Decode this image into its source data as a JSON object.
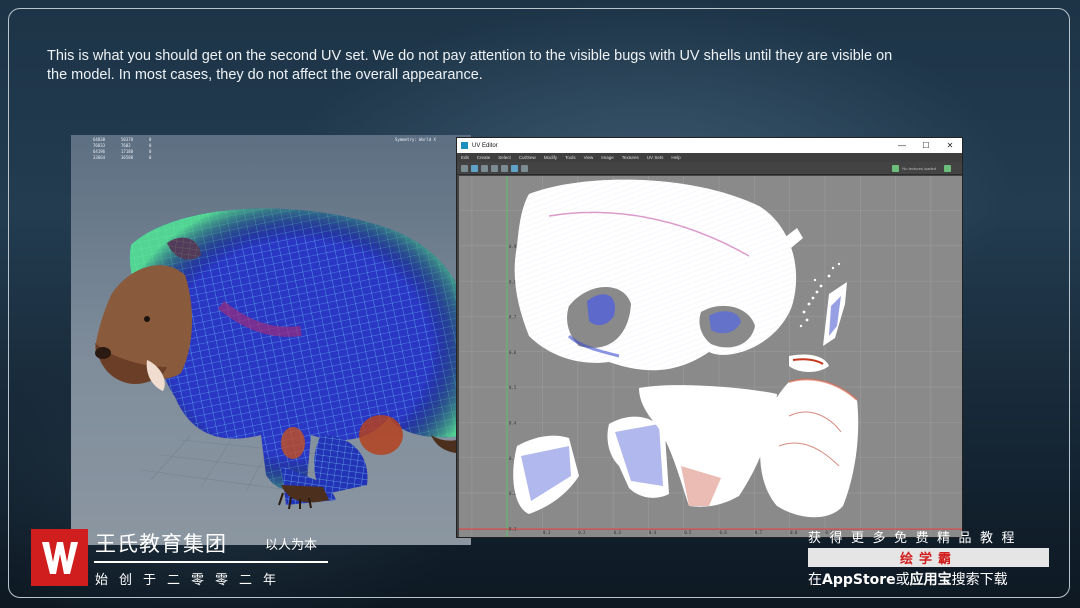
{
  "caption": "This is what you should get on the second UV set. We do not pay attention to the visible bugs with UV shells until they are visible on the model. In most cases, they do not affect the overall appearance.",
  "viewport": {
    "hud_rows": [
      [
        "64830",
        "50378",
        "0"
      ],
      [
        "76833",
        "7602",
        "0"
      ],
      [
        "64196",
        "17188",
        "0"
      ],
      [
        "33664",
        "36588",
        "0"
      ]
    ],
    "symmetry": "Symmetry: World X"
  },
  "uv_editor": {
    "title": "UV Editor",
    "window_buttons": {
      "minimize": "—",
      "maximize": "☐",
      "close": "✕"
    },
    "menu": [
      "Edit",
      "Create",
      "Select",
      "Cut/Sew",
      "Modify",
      "Tools",
      "View",
      "Image",
      "Textures",
      "UV Sets",
      "Help"
    ],
    "toolbar_status": "No textures loaded",
    "v_ticks": [
      "0.9",
      "0.8",
      "0.7",
      "0.6",
      "0.5",
      "0.4",
      "0.3",
      "0.2",
      "0.1"
    ],
    "u_ticks": [
      "0.1",
      "0.2",
      "0.3",
      "0.4",
      "0.5",
      "0.6",
      "0.7",
      "0.8",
      "0.9"
    ]
  },
  "branding": {
    "logo_letter": "W",
    "name": "王氏教育集团",
    "slogan": "以人为本",
    "founded": "始创于二零零二年"
  },
  "promo": {
    "line1": "获得更多免费精品教程",
    "banner": "绘学霸",
    "line3_prefix": "在",
    "line3_app": "AppStore",
    "line3_or": "或",
    "line3_store": "应用宝",
    "line3_suffix": "搜索下载"
  },
  "colors": {
    "brand_red": "#d01e1e",
    "uv_shell_fill": "#ffffff",
    "uv_canvas": "#8a8a8a",
    "wireframe_blue": "#2637c8",
    "wireframe_green": "#3fe08a"
  }
}
